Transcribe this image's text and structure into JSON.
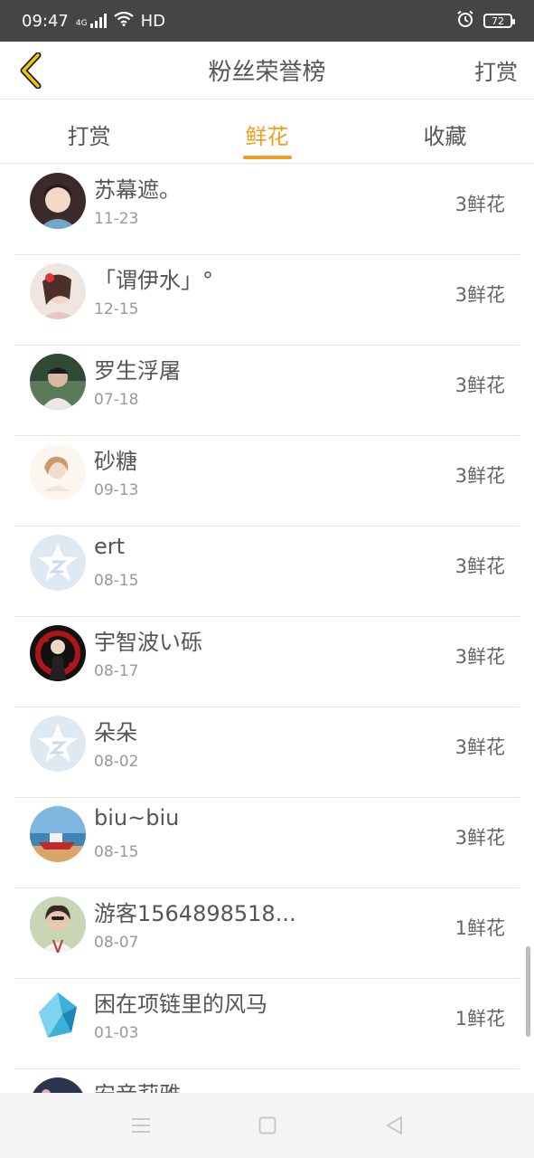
{
  "status_bar": {
    "time": "09:47",
    "network": "4G",
    "hd": "HD",
    "battery": "72"
  },
  "header": {
    "title": "粉丝荣誉榜",
    "action_label": "打赏"
  },
  "tabs": [
    {
      "label": "打赏",
      "active": false
    },
    {
      "label": "鲜花",
      "active": true
    },
    {
      "label": "收藏",
      "active": false
    }
  ],
  "accent_color": "#f0a020",
  "fans": [
    {
      "name": "苏幕遮。",
      "date": "11-23",
      "amount": "3鲜花",
      "avatar": "photo"
    },
    {
      "name": "「谓伊水」°",
      "date": "12-15",
      "amount": "3鲜花",
      "avatar": "photo"
    },
    {
      "name": "罗生浮屠",
      "date": "07-18",
      "amount": "3鲜花",
      "avatar": "photo"
    },
    {
      "name": "砂糖",
      "date": "09-13",
      "amount": "3鲜花",
      "avatar": "photo"
    },
    {
      "name": "ert",
      "date": "08-15",
      "amount": "3鲜花",
      "avatar": "default-qq"
    },
    {
      "name": "宇智波い砾",
      "date": "08-17",
      "amount": "3鲜花",
      "avatar": "photo"
    },
    {
      "name": "朵朵",
      "date": "08-02",
      "amount": "3鲜花",
      "avatar": "default-qq"
    },
    {
      "name": "biu~biu",
      "date": "08-15",
      "amount": "3鲜花",
      "avatar": "photo"
    },
    {
      "name": "游客1564898518...",
      "date": "08-07",
      "amount": "1鲜花",
      "avatar": "photo"
    },
    {
      "name": "困在项链里的风马",
      "date": "01-03",
      "amount": "1鲜花",
      "avatar": "photo"
    },
    {
      "name": "安音莉雅",
      "date": "",
      "amount": "",
      "avatar": "photo"
    }
  ]
}
